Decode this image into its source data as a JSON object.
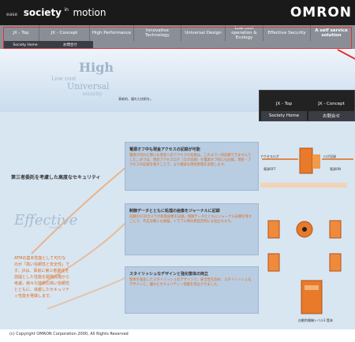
{
  "header": {
    "brand_small": "ease",
    "brand_society": "society",
    "brand_sup": "in",
    "brand_motion": "motion",
    "logo": "OMRON"
  },
  "nav": {
    "items": [
      {
        "label": "JX - Top"
      },
      {
        "label": "JX - Concept"
      },
      {
        "label": "High Performance"
      },
      {
        "label": "Innovative Technology"
      },
      {
        "label": "Universal Design"
      },
      {
        "label": "Low cost operation & Ecology"
      },
      {
        "label": "Effective Security"
      },
      {
        "label": "A self service solution"
      }
    ],
    "sub": [
      {
        "label": "Society Home"
      },
      {
        "label": "お問合せ"
      }
    ]
  },
  "hero": {
    "words": [
      "High",
      "Low cost",
      "Universal",
      "security"
    ],
    "tagline": "革新的、優れた技術を。"
  },
  "popup": {
    "items": [
      "JX - Top",
      "JX - Concept",
      "Society Home",
      "お問合せ"
    ]
  },
  "content": {
    "section_title": "第三者委託を考慮した高度なセキュリティ",
    "effective": "Effective",
    "effective_sub": "security",
    "left_text": "ATMの基本性能として可欠なのが「高い信頼性と安全性」です。JXは、事前に第三者委託を前提とした性能を開発段階から考慮。様々な技術の高い信頼性とともに、卓越したセキュリティ性能を発揮します。",
    "boxes": [
      {
        "title": "電源オフ中も現金アクセスの記録が可能",
        "body": "電源が切れた際にも現金へのアクセスの有無は、これまで一切記録できませんでした。JXでは、現金アクセスログ（ログ記録）を電源オフ時にも記録。現金・アクセスの記録を残すことで、より確実な現金管理を実現します。"
      },
      {
        "title": "制御データとともに処理の画像をジャーナルに記録",
        "body": "内蔵のCCDカメラが処理画像を記録。制御データとともにジャーナル記録を残すことで、不正対策にも貢献。トラブル時の原因究明にも役立ちます。"
      },
      {
        "title": "スタイリッシュなデザインと強化筐体の両立",
        "body": "筐体を強化したスタイリッシュなデザインで、安全性を高め、スタイリッシュなデザインと、優れたセキュリティー性能を両立させました。"
      }
    ],
    "labels": {
      "power_off": "電源OFF",
      "power_on": "電源ON",
      "access_log": "アクセスログ",
      "log_record": "ログ記録",
      "dispenser": "自動釣銭機レベル3 筐体"
    }
  },
  "footer": {
    "copyright": "(c) Copyright OMRON Corporation 2000, All Rights Reserved"
  },
  "colors": {
    "header_bg": "#1a1a1a",
    "nav_bg": "#8a8f97",
    "accent_orange": "#e06a1a",
    "panel_blue": "#b9cde2"
  }
}
